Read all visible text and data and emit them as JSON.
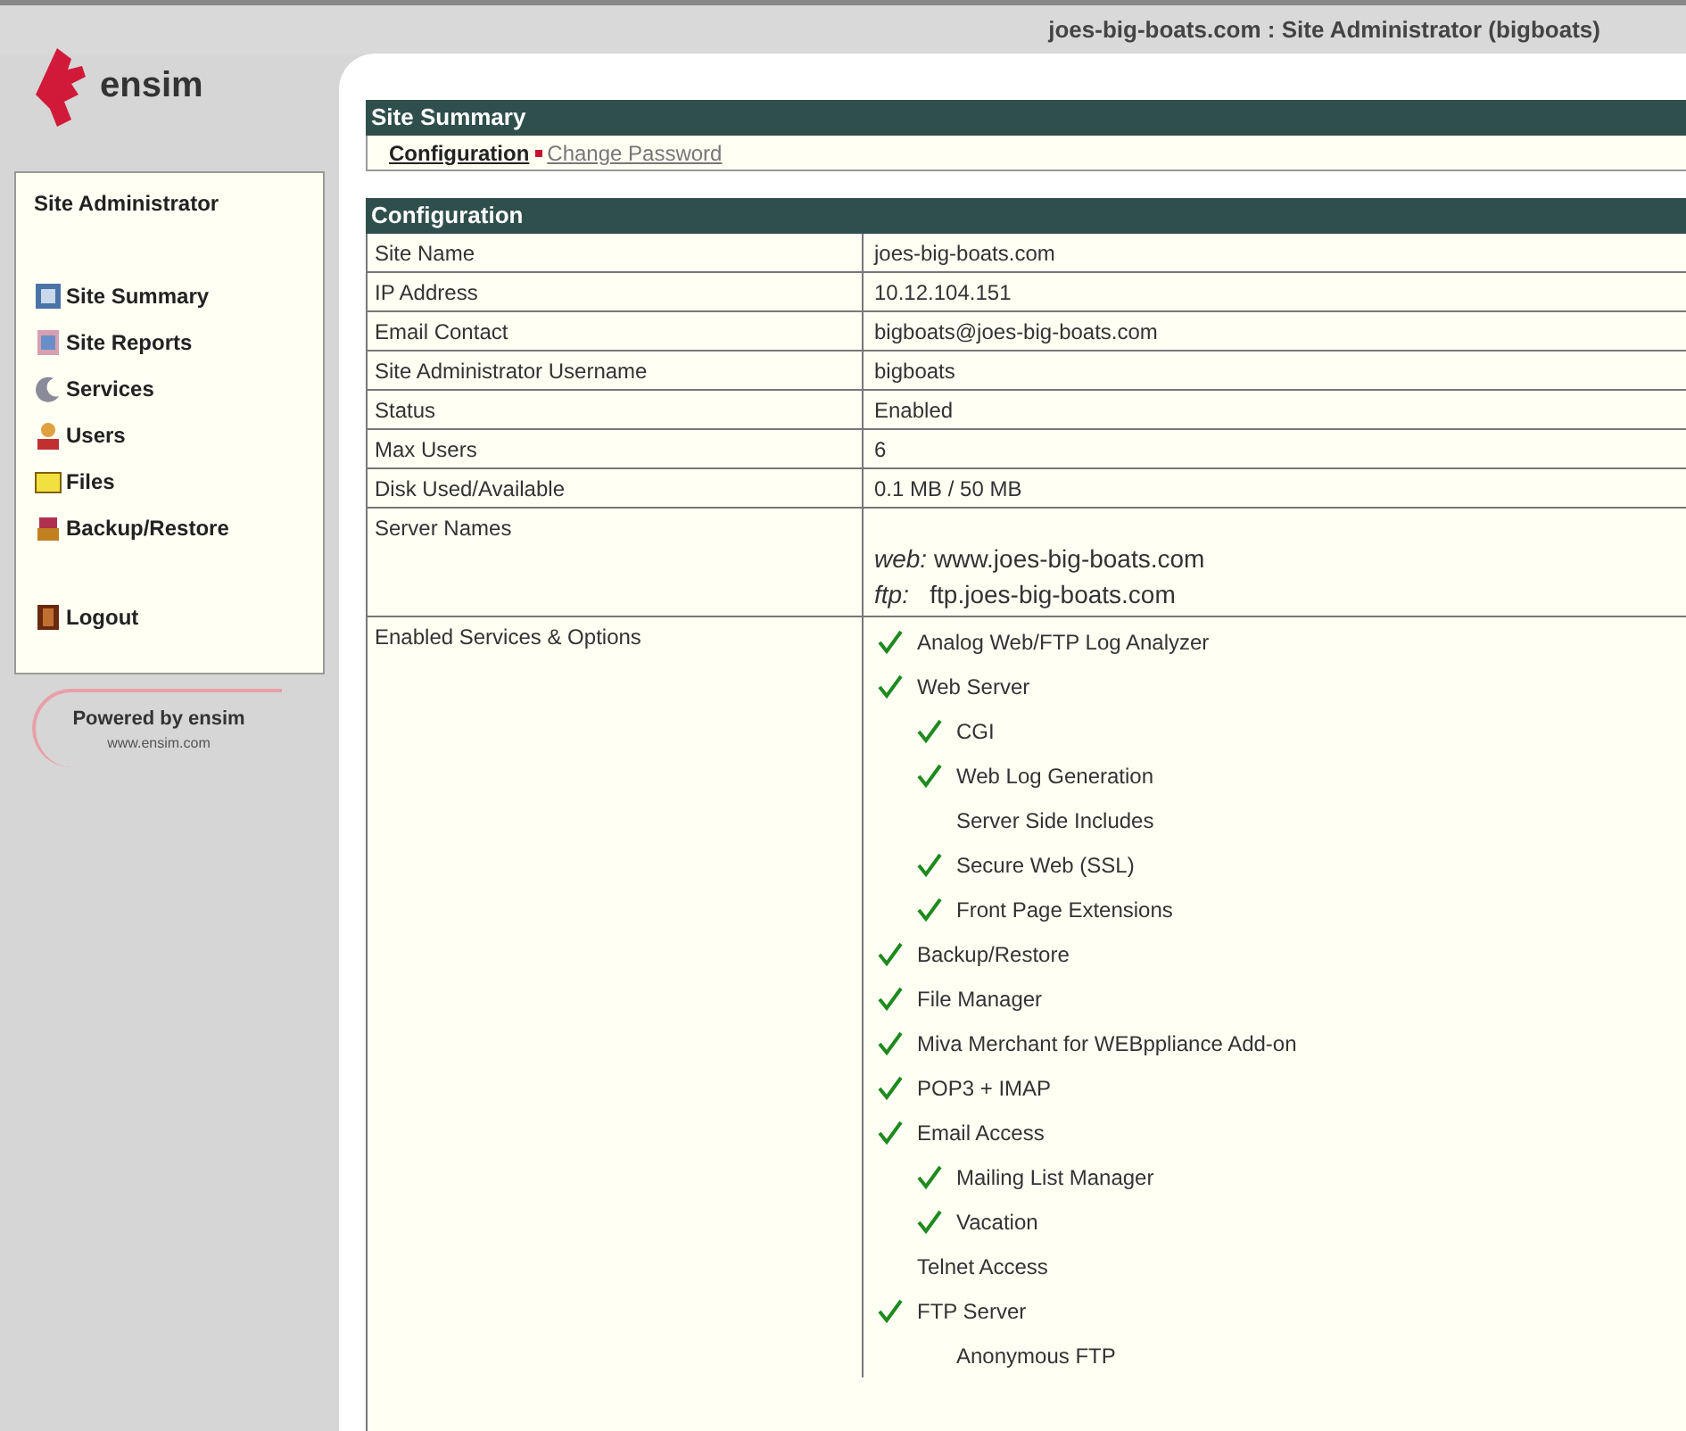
{
  "header": {
    "title": "joes-big-boats.com : Site Administrator (bigboats)"
  },
  "logo": {
    "text": "ensim"
  },
  "sidebar": {
    "title": "Site Administrator",
    "items": [
      {
        "label": "Site Summary"
      },
      {
        "label": "Site Reports"
      },
      {
        "label": "Services"
      },
      {
        "label": "Users"
      },
      {
        "label": "Files"
      },
      {
        "label": "Backup/Restore"
      },
      {
        "label": "Logout"
      }
    ],
    "powered": {
      "text": "Powered by ensim",
      "url": "www.ensim.com"
    }
  },
  "summary": {
    "title": "Site Summary",
    "tabs": [
      {
        "label": "Configuration",
        "selected": true
      },
      {
        "label": "Change Password",
        "selected": false
      }
    ]
  },
  "configuration": {
    "title": "Configuration",
    "rows": [
      {
        "label": "Site Name",
        "value": "joes-big-boats.com"
      },
      {
        "label": "IP Address",
        "value": "10.12.104.151"
      },
      {
        "label": "Email Contact",
        "value": "bigboats@joes-big-boats.com"
      },
      {
        "label": "Site Administrator Username",
        "value": "bigboats"
      },
      {
        "label": "Status",
        "value": "Enabled"
      },
      {
        "label": "Max Users",
        "value": "6"
      },
      {
        "label": "Disk Used/Available",
        "value": "0.1 MB / 50 MB"
      }
    ],
    "server_names": {
      "label": "Server Names",
      "lines": [
        "*web:* www.joes-big-boats.com",
        "*ftp:*   ftp.joes-big-boats.com"
      ]
    },
    "services": {
      "label": "Enabled Services & Options",
      "items": [
        {
          "label": "Analog Web/FTP Log Analyzer",
          "checked": true
        },
        {
          "label": "Web Server",
          "checked": true,
          "children": [
            {
              "label": "CGI",
              "checked": true
            },
            {
              "label": "Web Log Generation",
              "checked": true
            },
            {
              "label": "Server Side Includes",
              "checked": false
            },
            {
              "label": "Secure Web (SSL)",
              "checked": true
            },
            {
              "label": "Front Page Extensions",
              "checked": true
            }
          ]
        },
        {
          "label": "Backup/Restore",
          "checked": true
        },
        {
          "label": "File Manager",
          "checked": true
        },
        {
          "label": "Miva Merchant for WEBppliance Add-on",
          "checked": true
        },
        {
          "label": "POP3 + IMAP",
          "checked": true
        },
        {
          "label": "Email Access",
          "checked": true,
          "children": [
            {
              "label": "Mailing List Manager",
              "checked": true
            },
            {
              "label": "Vacation",
              "checked": true
            }
          ]
        },
        {
          "label": "Telnet Access",
          "checked": false
        },
        {
          "label": "FTP Server",
          "checked": true,
          "children": [
            {
              "label": "Anonymous FTP",
              "checked": false
            }
          ]
        }
      ]
    }
  }
}
